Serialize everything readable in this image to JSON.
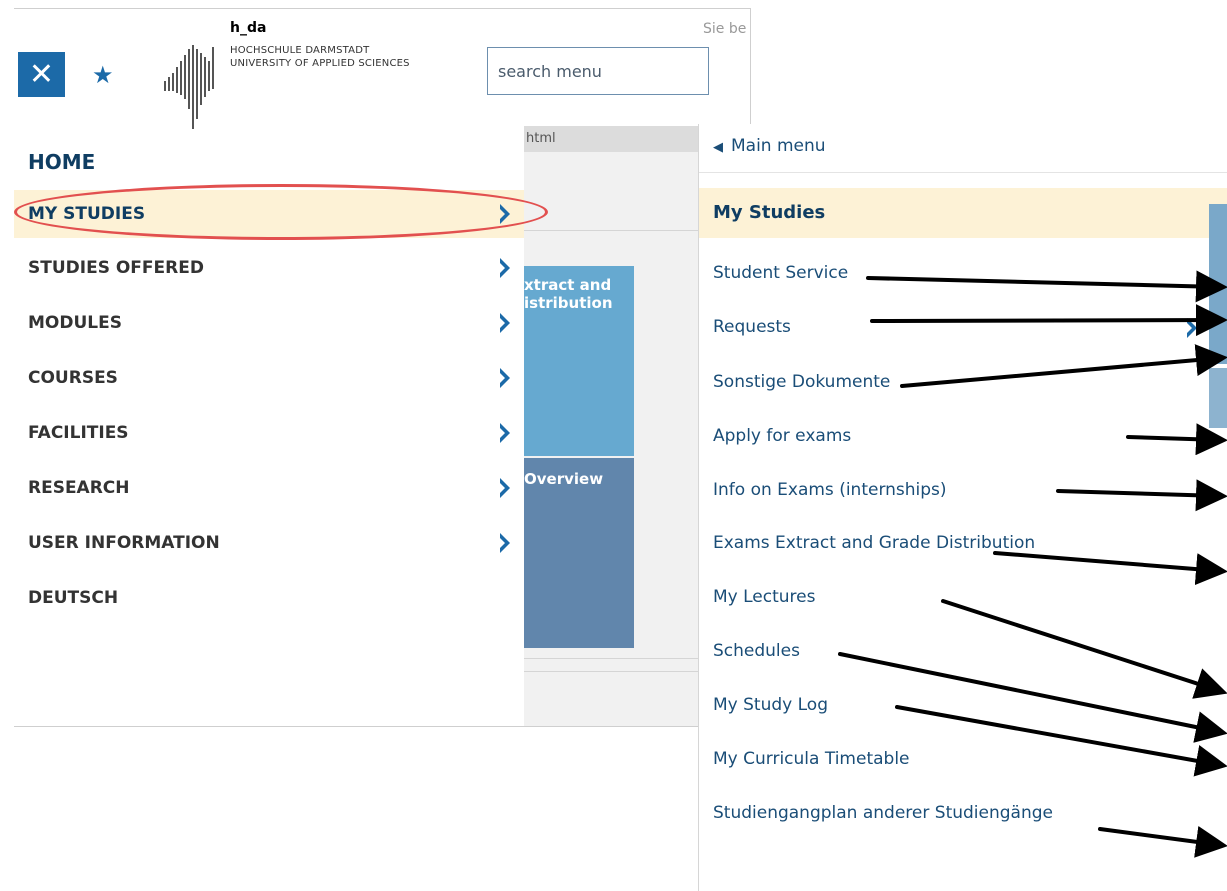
{
  "header": {
    "close_icon": "close-icon",
    "star_icon": "star-icon",
    "logo": {
      "name": "h_da",
      "line1": "HOCHSCHULE DARMSTADT",
      "line2": "UNIVERSITY OF APPLIED SCIENCES"
    },
    "search_placeholder": "search menu",
    "partial_text": "Sie be"
  },
  "left_menu": {
    "home": "HOME",
    "items": [
      {
        "label": "MY STUDIES",
        "active": true
      },
      {
        "label": "STUDIES OFFERED"
      },
      {
        "label": "MODULES"
      },
      {
        "label": "COURSES"
      },
      {
        "label": "FACILITIES"
      },
      {
        "label": "RESEARCH"
      },
      {
        "label": "USER INFORMATION"
      },
      {
        "label": "DEUTSCH"
      }
    ]
  },
  "background_page": {
    "header_text": "html",
    "tile1": "xtract and\nistribution",
    "tile2": "Overview"
  },
  "submenu": {
    "back_label": "Main menu",
    "title": "My Studies",
    "items": [
      "Student Service",
      "Requests",
      "Sonstige Dokumente",
      "Apply for exams",
      "Info on Exams (internships)",
      "Exams Extract and Grade Distribution",
      "My Lectures",
      "Schedules",
      "My Study Log",
      "My Curricula Timetable",
      "Studiengangplan anderer Studiengänge"
    ]
  },
  "colors": {
    "accent_blue": "#1c6aa8",
    "active_bg": "#fdf2d6",
    "highlight_red": "#e2504f",
    "nav_text_dark": "#0f3d62"
  }
}
